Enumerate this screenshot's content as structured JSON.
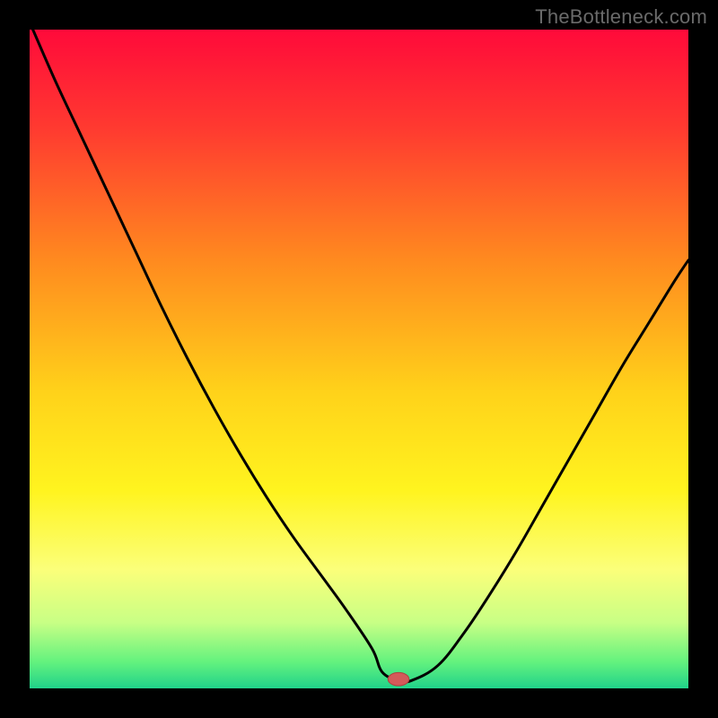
{
  "watermark": "TheBottleneck.com",
  "chart_data": {
    "type": "line",
    "title": "",
    "xlabel": "",
    "ylabel": "",
    "xlim": [
      0,
      100
    ],
    "ylim": [
      0,
      100
    ],
    "grid": false,
    "background_gradient": {
      "stops": [
        {
          "offset": 0.0,
          "color": "#ff0a3a"
        },
        {
          "offset": 0.15,
          "color": "#ff3a30"
        },
        {
          "offset": 0.35,
          "color": "#ff8a1f"
        },
        {
          "offset": 0.55,
          "color": "#ffd21a"
        },
        {
          "offset": 0.7,
          "color": "#fff41f"
        },
        {
          "offset": 0.82,
          "color": "#fbff7a"
        },
        {
          "offset": 0.9,
          "color": "#c8ff85"
        },
        {
          "offset": 0.96,
          "color": "#63f27e"
        },
        {
          "offset": 1.0,
          "color": "#20d28a"
        }
      ]
    },
    "series": [
      {
        "name": "bottleneck-curve",
        "stroke": "#000000",
        "stroke_width": 3,
        "x": [
          0.5,
          4,
          8,
          12,
          16,
          20,
          24,
          28,
          32,
          36,
          40,
          44,
          48,
          52,
          53.5,
          56,
          58,
          62,
          66,
          70,
          74,
          78,
          82,
          86,
          90,
          94,
          98,
          100
        ],
        "y": [
          100,
          92,
          83.5,
          75,
          66.5,
          58,
          50,
          42.5,
          35.5,
          29,
          23,
          17.5,
          12,
          6,
          2.5,
          1.2,
          1.2,
          3.5,
          8.5,
          14.5,
          21,
          28,
          35,
          42,
          49,
          55.5,
          62,
          65
        ]
      }
    ],
    "marker": {
      "name": "bottleneck-point",
      "x": 56,
      "y": 1.4,
      "rx": 1.6,
      "ry": 1.0,
      "fill": "#d45a5a",
      "stroke": "#b23f3f"
    }
  }
}
